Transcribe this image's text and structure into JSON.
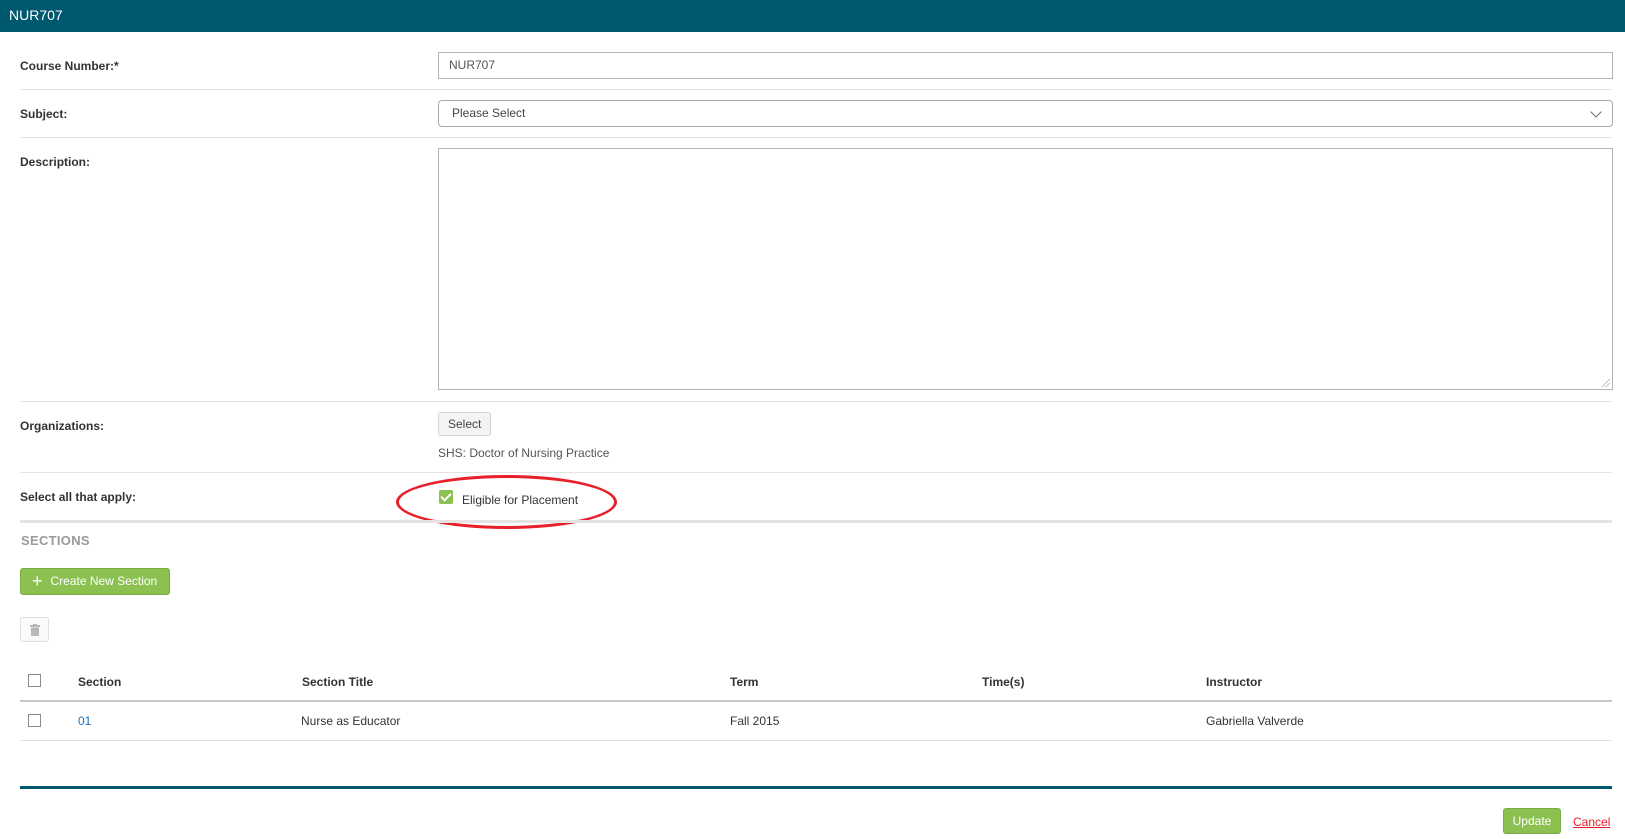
{
  "window": {
    "title": "NUR707"
  },
  "form": {
    "course_number": {
      "label": "Course Number:*",
      "value": "NUR707"
    },
    "subject": {
      "label": "Subject:",
      "selected": "Please Select"
    },
    "description": {
      "label": "Description:",
      "value": ""
    },
    "organizations": {
      "label": "Organizations:",
      "select_button": "Select",
      "selected_org": "SHS: Doctor of Nursing Practice"
    },
    "options": {
      "label": "Select all that apply:",
      "eligible_for_placement": {
        "label": "Eligible for Placement",
        "checked": true
      }
    }
  },
  "sections": {
    "title": "SECTIONS",
    "create_button": "Create New Section",
    "delete_icon": "trash-icon",
    "columns": [
      "Section",
      "Section Title",
      "Term",
      "Time(s)",
      "Instructor"
    ],
    "rows": [
      {
        "section": "01",
        "section_title": "Nurse as Educator",
        "term": "Fall 2015",
        "times": "",
        "instructor": "Gabriella Valverde"
      }
    ]
  },
  "footer": {
    "update_button": "Update",
    "cancel_link": "Cancel"
  },
  "colors": {
    "header": "#00586f",
    "accent_green": "#8cc152",
    "highlight_red": "#e8202a",
    "link_blue": "#1a6fb5"
  }
}
